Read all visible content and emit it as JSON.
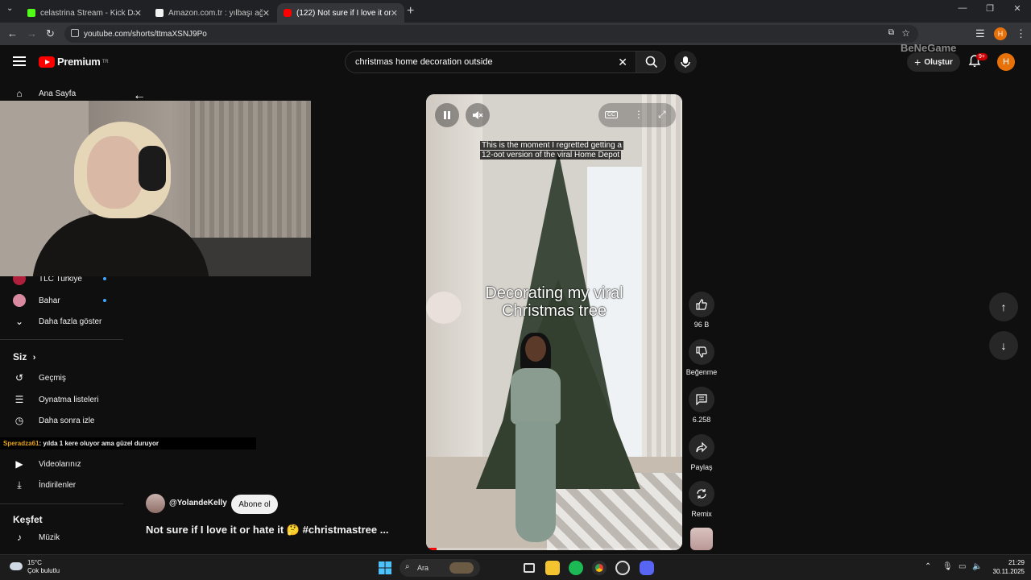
{
  "browser": {
    "tabs": [
      {
        "label": "celastrina Stream - Kick Dashboard",
        "color": "#53fc18"
      },
      {
        "label": "Amazon.com.tr : yılbaşı ağacı",
        "color": "#f2f2f2"
      },
      {
        "label": "(122) Not sure if I love it or hate it",
        "color": "#ff0000"
      }
    ],
    "url": "youtube.com/shorts/ttmaXSNJ9Po",
    "profile_initial": "H"
  },
  "header": {
    "brand": "Premium",
    "brand_region": "TR",
    "search_value": "christmas home decoration outside",
    "create_label": "Oluştur",
    "notif_badge": "9+",
    "avatar_initial": "H",
    "watermark": "BeNeGame"
  },
  "sidebar": {
    "home": "Ana Sayfa",
    "channels": [
      {
        "label": "TLC Turkiye"
      },
      {
        "label": "Bahar"
      }
    ],
    "show_more": "Daha fazla göster",
    "you_section": "Siz",
    "you_items": [
      {
        "label": "Geçmiş",
        "icon": "history-icon"
      },
      {
        "label": "Oynatma listeleri",
        "icon": "playlist-icon"
      },
      {
        "label": "Daha sonra izle",
        "icon": "clock-icon"
      },
      {
        "label": "Videolarınız",
        "icon": "video-icon"
      },
      {
        "label": "İndirilenler",
        "icon": "download-icon"
      }
    ],
    "explore_section": "Keşfet",
    "explore_items": [
      {
        "label": "Müzik",
        "icon": "music-icon"
      }
    ]
  },
  "chat": {
    "user": "Speradza61",
    "message": ": yılda 1 kere oluyor ama güzel duruyor"
  },
  "video": {
    "caption_line1": "This is the moment I regretted getting a",
    "caption_line2": "12-oot version of the viral Home Depot",
    "overlay_line1": "Decorating my viral",
    "overlay_line2": "Christmas tree",
    "cc_label": "CC",
    "progress": 0.04
  },
  "actions": {
    "likes": "96 B",
    "dislike": "Beğenme",
    "comments": "6.258",
    "share": "Paylaş",
    "remix": "Remix"
  },
  "channel": {
    "handle": "@YolandeKelly",
    "subscribe": "Abone ol",
    "title": "Not sure if I love it or hate it 🤔 #christmastree ..."
  },
  "taskbar": {
    "temp": "15°C",
    "weather": "Çok bulutlu",
    "search": "Ara",
    "time": "21:29",
    "date": "30.11.2025"
  }
}
